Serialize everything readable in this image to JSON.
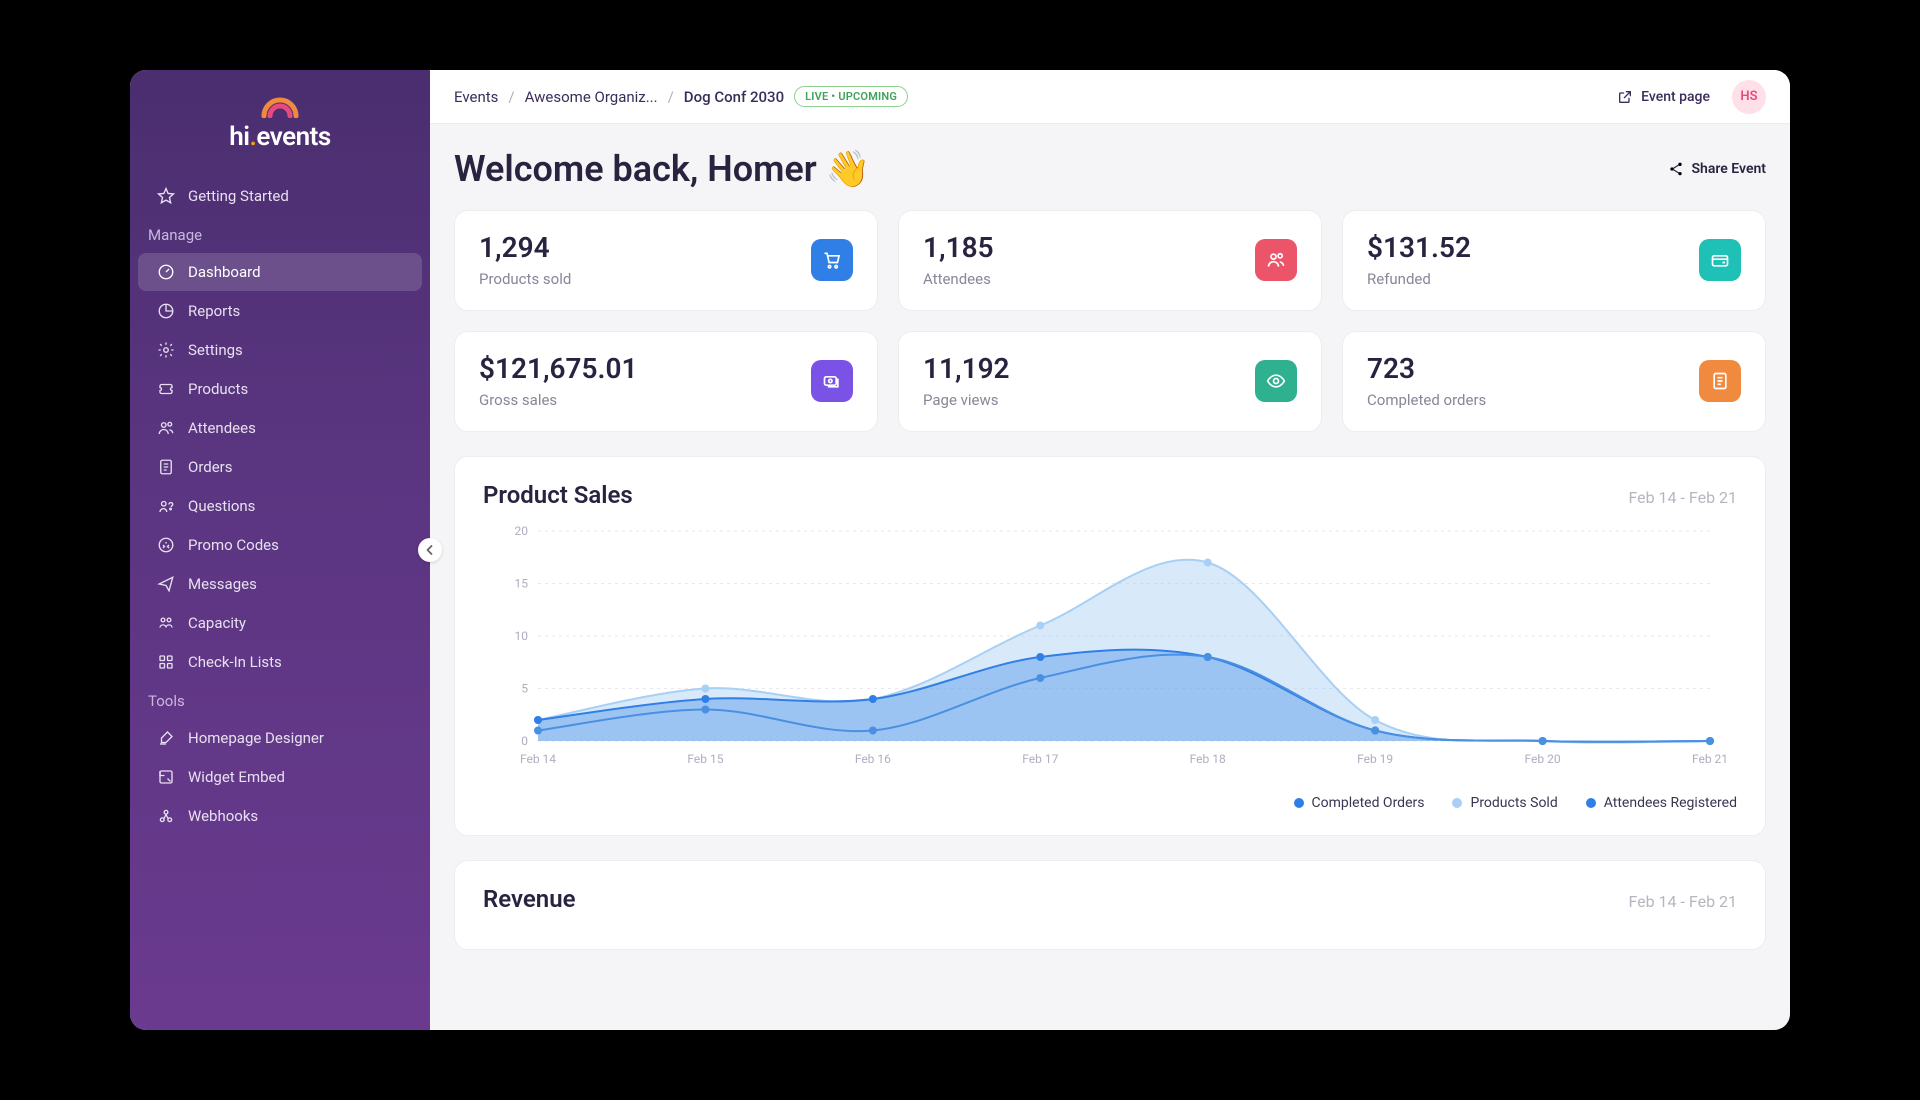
{
  "logo": {
    "name": "hi",
    "suffix": "events"
  },
  "sidebar": {
    "sections": [
      {
        "label": null,
        "items": [
          {
            "icon": "star",
            "label": "Getting Started",
            "active": false
          }
        ]
      },
      {
        "label": "Manage",
        "items": [
          {
            "icon": "gauge",
            "label": "Dashboard",
            "active": true
          },
          {
            "icon": "pie",
            "label": "Reports",
            "active": false
          },
          {
            "icon": "gear",
            "label": "Settings",
            "active": false
          },
          {
            "icon": "ticket",
            "label": "Products",
            "active": false
          },
          {
            "icon": "users",
            "label": "Attendees",
            "active": false
          },
          {
            "icon": "receipt",
            "label": "Orders",
            "active": false
          },
          {
            "icon": "question",
            "label": "Questions",
            "active": false
          },
          {
            "icon": "tag",
            "label": "Promo Codes",
            "active": false
          },
          {
            "icon": "send",
            "label": "Messages",
            "active": false
          },
          {
            "icon": "capacity",
            "label": "Capacity",
            "active": false
          },
          {
            "icon": "grid",
            "label": "Check-In Lists",
            "active": false
          }
        ]
      },
      {
        "label": "Tools",
        "items": [
          {
            "icon": "brush",
            "label": "Homepage Designer",
            "active": false
          },
          {
            "icon": "embed",
            "label": "Widget Embed",
            "active": false
          },
          {
            "icon": "webhook",
            "label": "Webhooks",
            "active": false
          }
        ]
      }
    ]
  },
  "breadcrumb": {
    "root": "Events",
    "org": "Awesome Organiz...",
    "event": "Dog Conf 2030"
  },
  "status_pill": "LIVE • UPCOMING",
  "topbar": {
    "event_page": "Event page",
    "avatar": "HS"
  },
  "welcome": "Welcome back, Homer 👋",
  "share_label": "Share Event",
  "stats": [
    {
      "value": "1,294",
      "label": "Products sold",
      "icon": "cart",
      "color": "ic-blue"
    },
    {
      "value": "1,185",
      "label": "Attendees",
      "icon": "users",
      "color": "ic-red"
    },
    {
      "value": "$131.52",
      "label": "Refunded",
      "icon": "refund",
      "color": "ic-teal"
    },
    {
      "value": "$121,675.01",
      "label": "Gross sales",
      "icon": "cash",
      "color": "ic-purple"
    },
    {
      "value": "11,192",
      "label": "Page views",
      "icon": "eye",
      "color": "ic-green"
    },
    {
      "value": "723",
      "label": "Completed orders",
      "icon": "doc",
      "color": "ic-orange"
    }
  ],
  "product_sales": {
    "title": "Product Sales",
    "range": "Feb 14 - Feb 21",
    "legend": [
      {
        "label": "Completed Orders",
        "color": "#2f7fe6"
      },
      {
        "label": "Products Sold",
        "color": "#a8d0f5"
      },
      {
        "label": "Attendees Registered",
        "color": "#2f7fe6"
      }
    ]
  },
  "revenue": {
    "title": "Revenue",
    "range": "Feb 14 - Feb 21"
  },
  "chart_data": {
    "type": "area",
    "title": "Product Sales",
    "xlabel": "",
    "ylabel": "",
    "ylim": [
      0,
      20
    ],
    "categories": [
      "Feb 14",
      "Feb 15",
      "Feb 16",
      "Feb 17",
      "Feb 18",
      "Feb 19",
      "Feb 20",
      "Feb 21"
    ],
    "series": [
      {
        "name": "Completed Orders",
        "values": [
          1,
          3,
          1,
          6,
          8,
          1,
          0,
          0
        ]
      },
      {
        "name": "Products Sold",
        "values": [
          2,
          5,
          4,
          11,
          17,
          2,
          0,
          0
        ]
      },
      {
        "name": "Attendees Registered",
        "values": [
          2,
          4,
          4,
          8,
          8,
          1,
          0,
          0
        ]
      }
    ]
  }
}
